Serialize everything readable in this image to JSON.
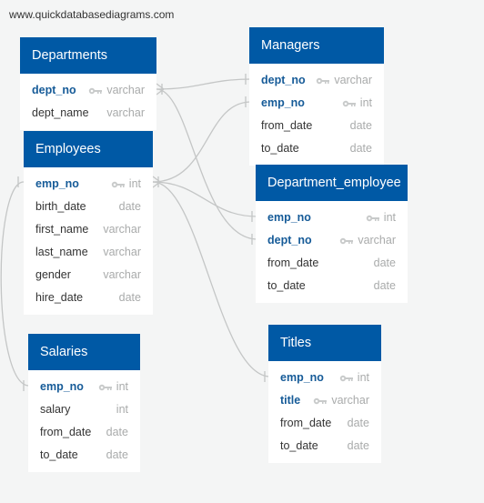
{
  "watermark": "www.quickdatabasediagrams.com",
  "colors": {
    "header": "#0059a5",
    "primary_key_text": "#165b98",
    "field_text": "#333333",
    "type_text": "#a9abab",
    "background": "#f4f5f5",
    "link_line": "#c4c6c6"
  },
  "tables": {
    "departments": {
      "name": "Departments",
      "fields": [
        {
          "name": "dept_no",
          "type": "varchar",
          "pk": true
        },
        {
          "name": "dept_name",
          "type": "varchar",
          "pk": false
        }
      ]
    },
    "employees": {
      "name": "Employees",
      "fields": [
        {
          "name": "emp_no",
          "type": "int",
          "pk": true
        },
        {
          "name": "birth_date",
          "type": "date",
          "pk": false
        },
        {
          "name": "first_name",
          "type": "varchar",
          "pk": false
        },
        {
          "name": "last_name",
          "type": "varchar",
          "pk": false
        },
        {
          "name": "gender",
          "type": "varchar",
          "pk": false
        },
        {
          "name": "hire_date",
          "type": "date",
          "pk": false
        }
      ]
    },
    "managers": {
      "name": "Managers",
      "fields": [
        {
          "name": "dept_no",
          "type": "varchar",
          "pk": true
        },
        {
          "name": "emp_no",
          "type": "int",
          "pk": true
        },
        {
          "name": "from_date",
          "type": "date",
          "pk": false
        },
        {
          "name": "to_date",
          "type": "date",
          "pk": false
        }
      ]
    },
    "department_employee": {
      "name": "Department_employee",
      "fields": [
        {
          "name": "emp_no",
          "type": "int",
          "pk": true
        },
        {
          "name": "dept_no",
          "type": "varchar",
          "pk": true
        },
        {
          "name": "from_date",
          "type": "date",
          "pk": false
        },
        {
          "name": "to_date",
          "type": "date",
          "pk": false
        }
      ]
    },
    "salaries": {
      "name": "Salaries",
      "fields": [
        {
          "name": "emp_no",
          "type": "int",
          "pk": true
        },
        {
          "name": "salary",
          "type": "int",
          "pk": false
        },
        {
          "name": "from_date",
          "type": "date",
          "pk": false
        },
        {
          "name": "to_date",
          "type": "date",
          "pk": false
        }
      ]
    },
    "titles": {
      "name": "Titles",
      "fields": [
        {
          "name": "emp_no",
          "type": "int",
          "pk": true
        },
        {
          "name": "title",
          "type": "varchar",
          "pk": true
        },
        {
          "name": "from_date",
          "type": "date",
          "pk": false
        },
        {
          "name": "to_date",
          "type": "date",
          "pk": false
        }
      ]
    }
  },
  "relationships": [
    {
      "from": "Departments.dept_no",
      "to": "Managers.dept_no",
      "from_end": "many",
      "to_end": "one"
    },
    {
      "from": "Departments.dept_no",
      "to": "Department_employee.dept_no",
      "from_end": "many",
      "to_end": "one"
    },
    {
      "from": "Employees.emp_no",
      "to": "Managers.emp_no",
      "from_end": "many",
      "to_end": "one"
    },
    {
      "from": "Employees.emp_no",
      "to": "Department_employee.emp_no",
      "from_end": "many",
      "to_end": "one"
    },
    {
      "from": "Employees.emp_no",
      "to": "Titles.emp_no",
      "from_end": "many",
      "to_end": "one"
    },
    {
      "from": "Employees.emp_no",
      "to": "Salaries.emp_no",
      "from_end": "one",
      "to_end": "one"
    }
  ]
}
